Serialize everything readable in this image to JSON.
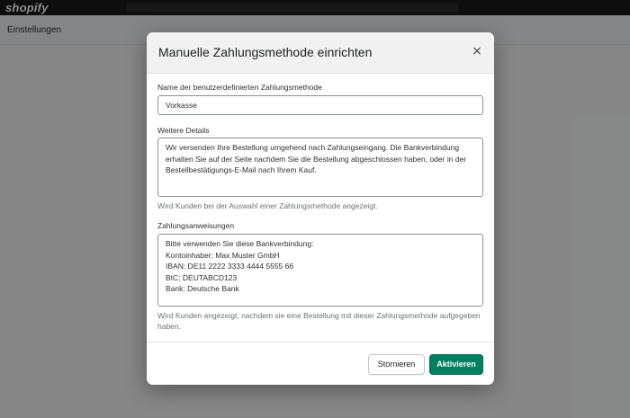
{
  "app": {
    "brand": "shopify",
    "subheader_title": "Einstellungen"
  },
  "modal": {
    "title": "Manuelle Zahlungsmethode einrichten",
    "close_symbol": "×",
    "name_field": {
      "label": "Name der benutzerdefinierten Zahlungsmethode",
      "value": "Vorkasse"
    },
    "details_field": {
      "label": "Weitere Details",
      "value": "Wir versenden Ihre Bestellung umgehend nach Zahlungseingang. Die Bankverbindung erhalten Sie auf der Seite nachdem Sie die Bestellung abgeschlossen haben, oder in der Bestellbestätigungs-E-Mail nach Ihrem Kauf.",
      "help": "Wird Kunden bei der Auswahl einer Zahlungsmethode angezeigt."
    },
    "instructions_field": {
      "label": "Zahlungsanweisungen",
      "value": "Bitte verwenden Sie diese Bankverbindung:\nKontoinhaber: Max Muster GmbH\nIBAN: DE11 2222 3333 4444 5555 66\nBIC: DEUTABCD123\nBank: Deutsche Bank",
      "help": "Wird Kunden angezeigt, nachdem sie eine Bestellung mit dieser Zahlungsmethode aufgegeben haben."
    },
    "footer": {
      "cancel_label": "Stornieren",
      "activate_label": "Aktivieren"
    }
  },
  "colors": {
    "primary": "#008060",
    "overlay": "rgba(0,0,0,0.45)"
  },
  "icons": {
    "close": "close-icon"
  }
}
